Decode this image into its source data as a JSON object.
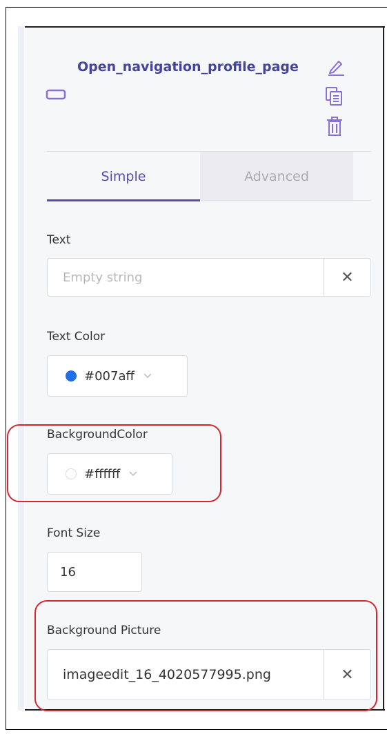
{
  "component": {
    "title": "Open_navigation_profile_page"
  },
  "tabs": [
    {
      "label": "Simple",
      "active": true
    },
    {
      "label": "Advanced",
      "active": false
    }
  ],
  "fields": {
    "text": {
      "label": "Text",
      "value": "",
      "placeholder": "Empty string",
      "clear": "✕"
    },
    "text_color": {
      "label": "Text Color",
      "value": "#007aff",
      "swatch": "#1f6fe8"
    },
    "background_color": {
      "label": "BackgroundColor",
      "value": "#ffffff",
      "swatch": "#ffffff"
    },
    "font_size": {
      "label": "Font Size",
      "value": "16"
    },
    "background_picture": {
      "label": "Background Picture",
      "value": "imageedit_16_4020577995.png",
      "clear": "✕"
    }
  },
  "colors": {
    "accent": "#5a47b3",
    "title": "#43449a",
    "highlight": "#d7262c"
  },
  "icons": [
    "button-component-icon",
    "edit-icon",
    "duplicate-icon",
    "trash-icon",
    "chevron-down-icon",
    "close-icon"
  ]
}
